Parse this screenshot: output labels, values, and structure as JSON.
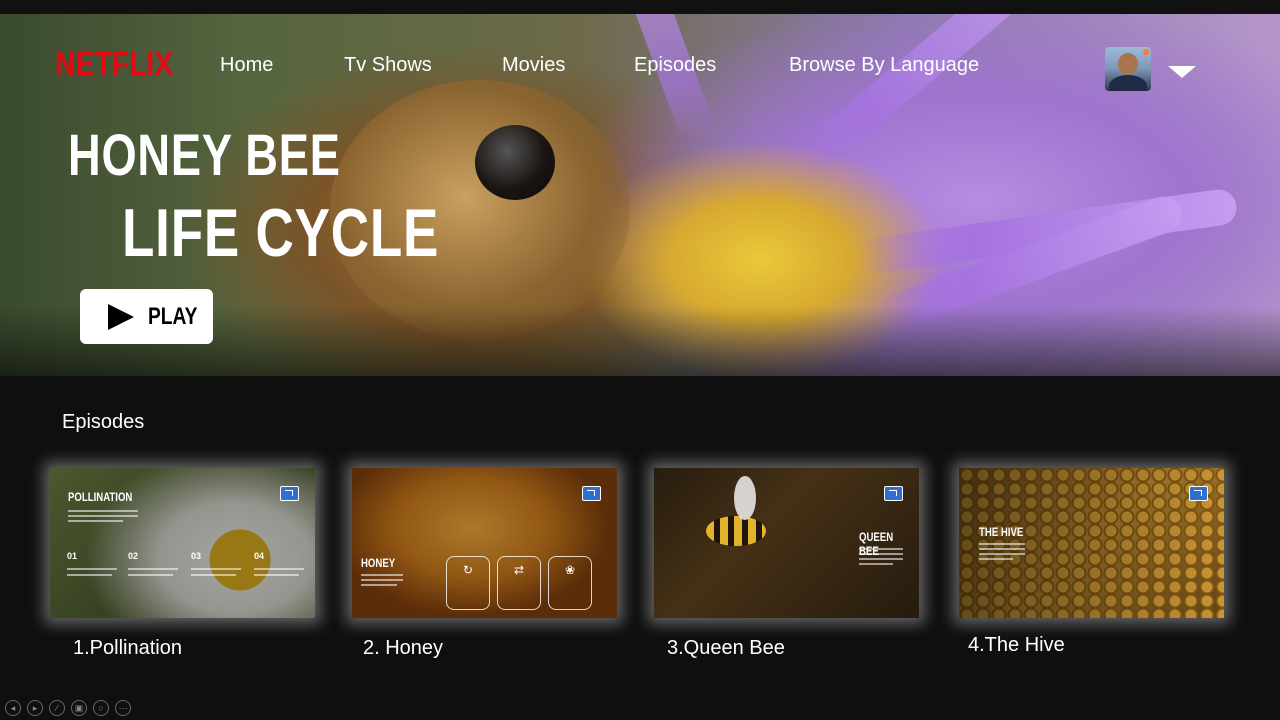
{
  "brand": {
    "logo_text": "NETFLIX",
    "logo_color": "#e50914"
  },
  "nav": {
    "items": [
      {
        "label": "Home"
      },
      {
        "label": "Tv Shows"
      },
      {
        "label": "Movies"
      },
      {
        "label": "Episodes"
      },
      {
        "label": "Browse By Language"
      }
    ]
  },
  "profile": {
    "avatar_icon": "user-avatar",
    "menu_icon": "caret-down-icon"
  },
  "hero": {
    "title_line1": "HONEY BEE",
    "title_line2": "LIFE CYCLE",
    "play_label": "PLAY",
    "play_icon": "play-icon"
  },
  "episodes": {
    "section_title": "Episodes",
    "items": [
      {
        "label": "1.Pollination",
        "thumb_title": "POLLINATION",
        "thumb_numbers": [
          "01",
          "02",
          "03",
          "04"
        ]
      },
      {
        "label": "2. Honey",
        "thumb_title": "HONEY",
        "thumb_icons": [
          "refresh-icon",
          "swap-icon",
          "brain-icon"
        ]
      },
      {
        "label": "3.Queen Bee",
        "thumb_title": "QUEEN BEE"
      },
      {
        "label": "4.The Hive",
        "thumb_title": "THE HIVE"
      }
    ]
  },
  "toolbar": {
    "buttons": [
      "previous-icon",
      "next-icon",
      "pen-icon",
      "slides-icon",
      "zoom-icon",
      "more-icon"
    ]
  }
}
